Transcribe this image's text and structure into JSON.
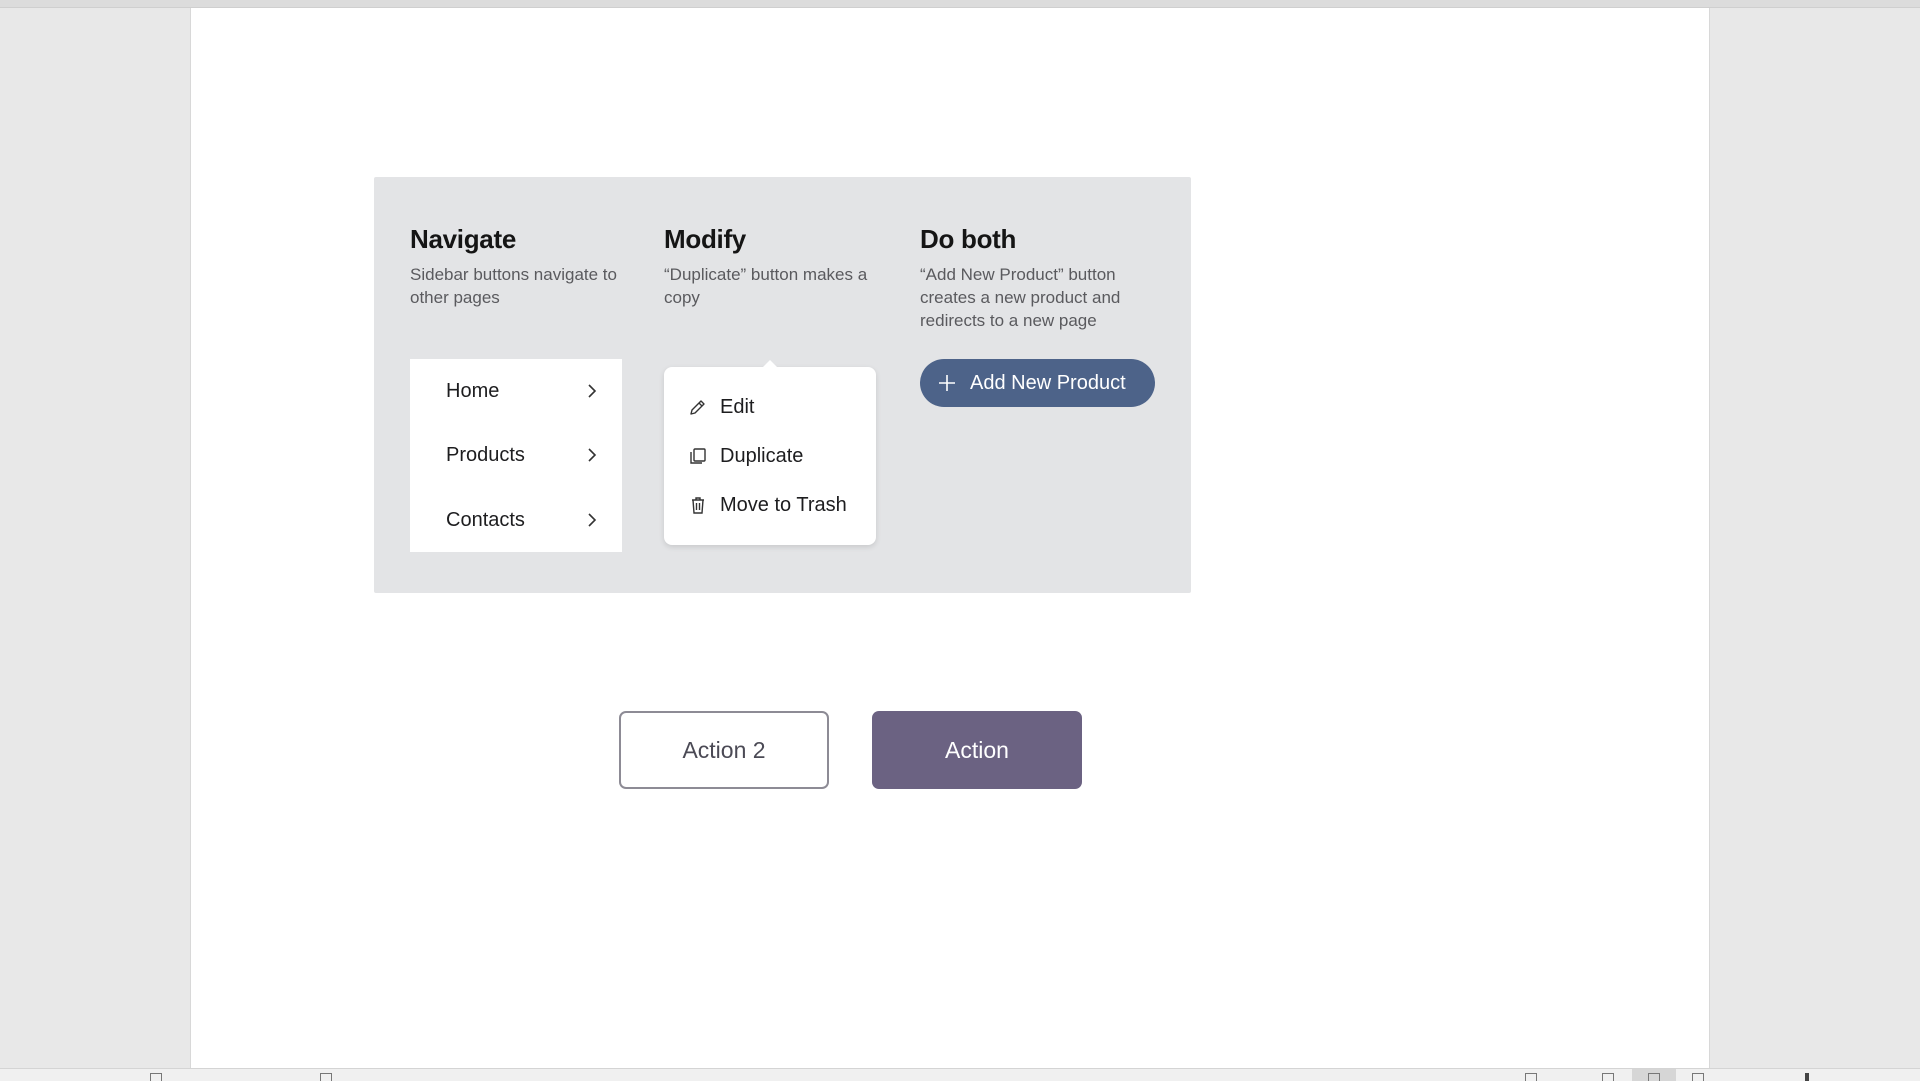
{
  "panel": {
    "columns": [
      {
        "title": "Navigate",
        "description": "Sidebar buttons navigate to other pages"
      },
      {
        "title": "Modify",
        "description": "“Duplicate” button makes a copy"
      },
      {
        "title": "Do both",
        "description": "“Add New Product” button creates a new product and redirects to a new page"
      }
    ],
    "nav_items": [
      {
        "label": "Home",
        "icon": "chevron-right-icon"
      },
      {
        "label": "Products",
        "icon": "chevron-right-icon"
      },
      {
        "label": "Contacts",
        "icon": "chevron-right-icon"
      }
    ],
    "menu_items": [
      {
        "label": "Edit",
        "icon": "pencil-icon"
      },
      {
        "label": "Duplicate",
        "icon": "copy-icon"
      },
      {
        "label": "Move to Trash",
        "icon": "trash-icon"
      }
    ],
    "add_button": {
      "label": "Add New Product",
      "icon": "plus-icon",
      "color": "#4d6389"
    }
  },
  "actions": {
    "secondary_label": "Action 2",
    "primary_label": "Action",
    "primary_color": "#6b6282"
  }
}
